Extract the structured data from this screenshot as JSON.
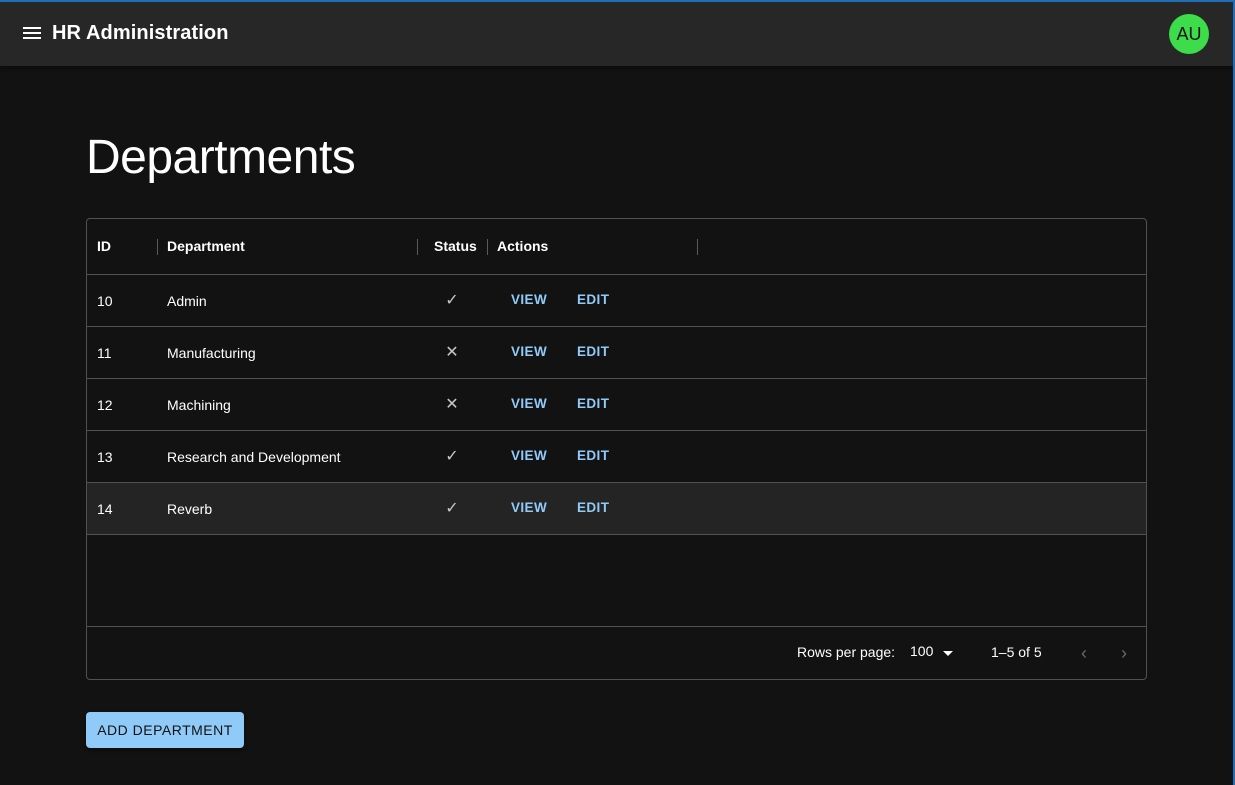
{
  "app": {
    "title": "HR Administration",
    "avatar_initials": "AU",
    "avatar_color": "#3ddc4a",
    "menu_icon": "menu-icon"
  },
  "page": {
    "title": "Departments"
  },
  "table": {
    "columns": [
      "ID",
      "Department",
      "Status",
      "Actions"
    ],
    "rows": [
      {
        "id": "10",
        "department": "Admin",
        "status": "active",
        "status_icon": "✓",
        "view": "VIEW",
        "edit": "EDIT"
      },
      {
        "id": "11",
        "department": "Manufacturing",
        "status": "inactive",
        "status_icon": "✕",
        "view": "VIEW",
        "edit": "EDIT"
      },
      {
        "id": "12",
        "department": "Machining",
        "status": "inactive",
        "status_icon": "✕",
        "view": "VIEW",
        "edit": "EDIT"
      },
      {
        "id": "13",
        "department": "Research and Development",
        "status": "active",
        "status_icon": "✓",
        "view": "VIEW",
        "edit": "EDIT"
      },
      {
        "id": "14",
        "department": "Reverb",
        "status": "active",
        "status_icon": "✓",
        "view": "VIEW",
        "edit": "EDIT"
      }
    ],
    "footer": {
      "rows_per_page_label": "Rows per page:",
      "rows_per_page_value": "100",
      "range_text": "1–5 of 5",
      "prev_icon": "‹",
      "next_icon": "›"
    }
  },
  "actions": {
    "add_label": "ADD DEPARTMENT"
  },
  "colors": {
    "accent": "#90caf9",
    "background": "#121212",
    "appbar": "#272727"
  }
}
